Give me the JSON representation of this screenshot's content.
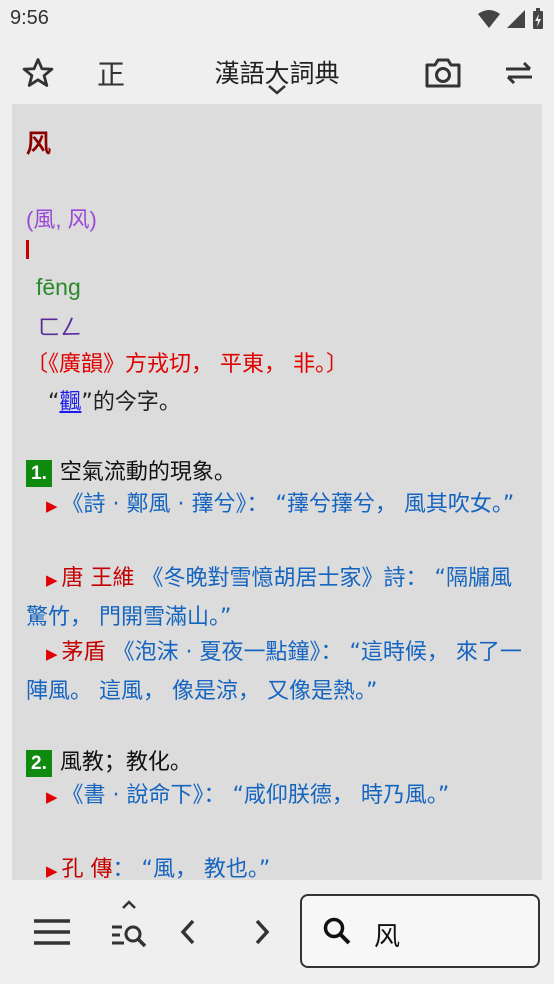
{
  "status": {
    "time": "9:56"
  },
  "toolbar": {
    "title": "漢語大詞典",
    "orthography_label": "正"
  },
  "entry": {
    "headword": "风",
    "variants": "(風, 风)",
    "pinyin": "fēng",
    "zhuyin": "ㄈㄥ",
    "source": "〔《廣韻》方戎切， 平東， 非。〕",
    "note_prefix": "“",
    "note_link": "飌",
    "note_suffix": "”的今字。",
    "senses": [
      {
        "num": "1.",
        "definition": "空氣流動的現象。",
        "quotes": [
          {
            "author": "",
            "text": "《詩 · 鄭風 · 蘀兮》： “蘀兮蘀兮， 風其吹女。”"
          },
          {
            "author": "唐 王維",
            "text": "《冬晚對雪憶胡居士家》詩： “隔牖風驚竹， 門開雪滿山。”"
          },
          {
            "author": "茅盾",
            "text": "《泡沫 · 夏夜一點鐘》： “這時候， 來了一陣風。 這風， 像是涼， 又像是熱。”"
          }
        ]
      },
      {
        "num": "2.",
        "definition": "風教；教化。",
        "quotes": [
          {
            "author": "",
            "text": "《書 · 說命下》： “咸仰朕德， 時乃風。”"
          },
          {
            "author": "孔 傳",
            "text": "： “風， 教也。”"
          }
        ]
      }
    ]
  },
  "search": {
    "value": "风"
  },
  "colors": {
    "headword": "#8b0000",
    "pinyin": "#2b8a2b",
    "source": "#e00000",
    "quote": "#1565c0",
    "sense_badge": "#0f8a0f"
  }
}
